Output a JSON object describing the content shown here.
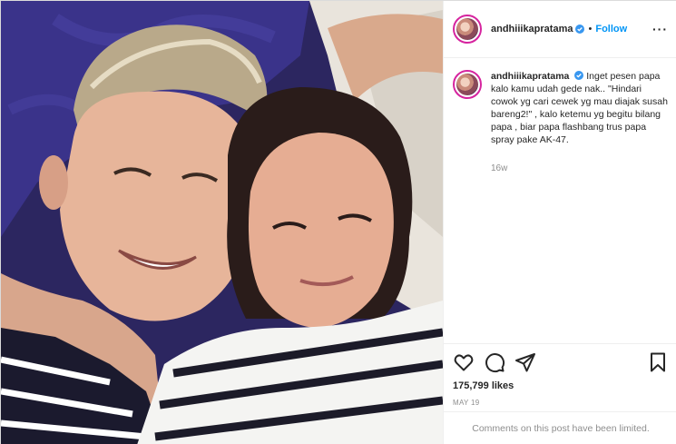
{
  "header": {
    "username": "andhiiikapratama",
    "separator": "•",
    "follow_label": "Follow",
    "more_label": "···"
  },
  "caption": {
    "username": "andhiiikapratama",
    "text": "Inget pesen papa kalo kamu udah gede nak.. \"Hindari cowok yg cari cewek yg mau diajak susah bareng2!\" , kalo ketemu yg begitu bilang papa , biar papa flashbang trus papa spray pake AK-47.",
    "time_ago": "16w"
  },
  "actions": {
    "icons": [
      "heart-icon",
      "comment-icon",
      "share-icon",
      "bookmark-icon"
    ],
    "likes": "175,799 likes",
    "date": "MAY 19"
  },
  "comments_notice": "Comments on this post have been limited.",
  "colors": {
    "link_blue": "#0095f6",
    "verified_blue": "#3897f0",
    "muted_gray": "#8e8e8e",
    "border": "#efefef"
  }
}
